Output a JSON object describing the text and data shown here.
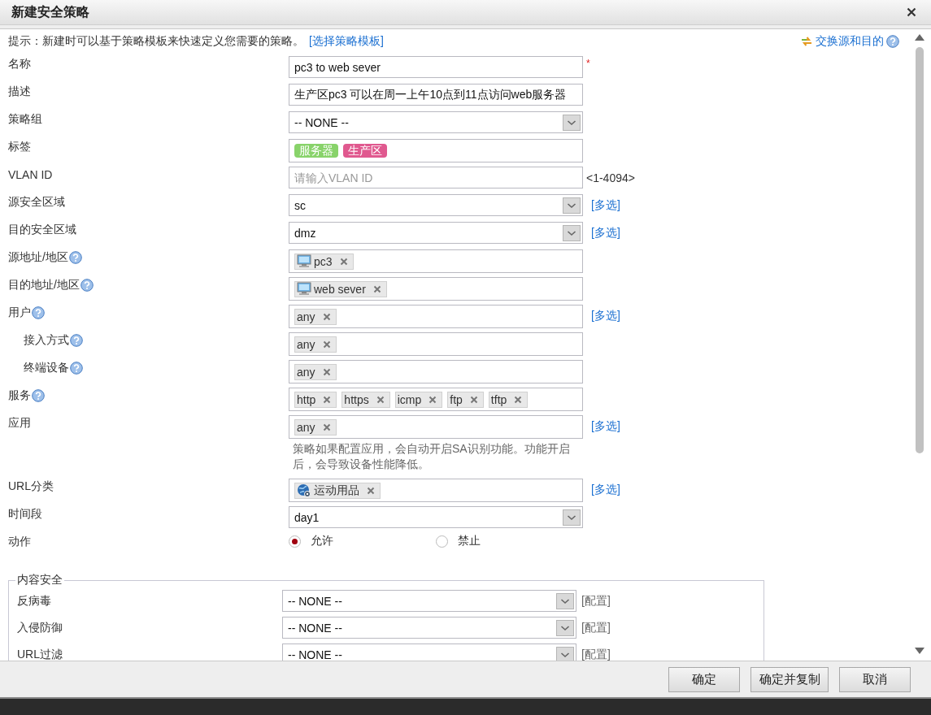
{
  "window": {
    "title": "新建安全策略"
  },
  "hint": {
    "text": "提示：新建时可以基于策略模板来快速定义您需要的策略。",
    "link": "[选择策略模板]"
  },
  "swap_link": {
    "text": "交换源和目的",
    "help": true
  },
  "fields": [
    {
      "label": "名称",
      "kind": "text",
      "value": "pc3 to web sever",
      "required_mark": "*"
    },
    {
      "label": "描述",
      "kind": "text",
      "value": "生产区pc3 可以在周一上午10点到11点访问web服务器"
    },
    {
      "label": "策略组",
      "kind": "select",
      "value": "-- NONE --"
    },
    {
      "label": "标签",
      "kind": "labels",
      "tags": [
        {
          "text": "服务器",
          "color": "#88d36a"
        },
        {
          "text": "生产区",
          "color": "#e0598f"
        }
      ]
    },
    {
      "label": "VLAN ID",
      "kind": "text",
      "placeholder": "请输入VLAN ID",
      "suffix": "<1-4094>"
    },
    {
      "label": "源安全区域",
      "kind": "select",
      "value": "sc",
      "link": "[多选]"
    },
    {
      "label": "目的安全区域",
      "kind": "select",
      "value": "dmz",
      "link": "[多选]"
    },
    {
      "label": "源地址/地区",
      "kind": "tokens",
      "help": true,
      "tokens": [
        {
          "text": "pc3",
          "kind": "host"
        }
      ]
    },
    {
      "label": "目的地址/地区",
      "kind": "tokens",
      "help": true,
      "tokens": [
        {
          "text": "web sever",
          "kind": "host"
        }
      ]
    },
    {
      "label": "用户",
      "kind": "tokens",
      "help": true,
      "link": "[多选]",
      "tokens": [
        {
          "text": "any"
        }
      ],
      "children": [
        {
          "label": "接入方式",
          "kind": "tokens",
          "help": true,
          "tokens": [
            {
              "text": "any"
            }
          ]
        },
        {
          "label": "终端设备",
          "kind": "tokens",
          "help": true,
          "tokens": [
            {
              "text": "any"
            }
          ]
        }
      ]
    },
    {
      "label": "服务",
      "kind": "tokens",
      "help": true,
      "tokens": [
        {
          "text": "http"
        },
        {
          "text": "https"
        },
        {
          "text": "icmp"
        },
        {
          "text": "ftp"
        },
        {
          "text": "tftp"
        }
      ]
    },
    {
      "label": "应用",
      "kind": "tokens",
      "link": "[多选]",
      "tokens": [
        {
          "text": "any"
        }
      ],
      "note": "策略如果配置应用，会自动开启SA识别功能。功能开启后，会导致设备性能降低。"
    },
    {
      "label": "URL分类",
      "kind": "tokens",
      "link": "[多选]",
      "tokens": [
        {
          "text": "运动用品",
          "kind": "category"
        }
      ]
    },
    {
      "label": "时间段",
      "kind": "select",
      "value": "day1"
    },
    {
      "label": "动作",
      "kind": "radio",
      "options": [
        {
          "label": "允许",
          "selected": true
        },
        {
          "label": "禁止",
          "selected": false
        }
      ]
    }
  ],
  "content_security": {
    "legend": "内容安全",
    "rows": [
      {
        "label": "反病毒",
        "value": "-- NONE --",
        "link": "[配置]"
      },
      {
        "label": "入侵防御",
        "value": "-- NONE --",
        "link": "[配置]"
      },
      {
        "label": "URL过滤",
        "value": "-- NONE --",
        "link": "[配置]"
      }
    ]
  },
  "buttons": [
    {
      "label": "确定"
    },
    {
      "label": "确定并复制"
    },
    {
      "label": "取消"
    }
  ]
}
